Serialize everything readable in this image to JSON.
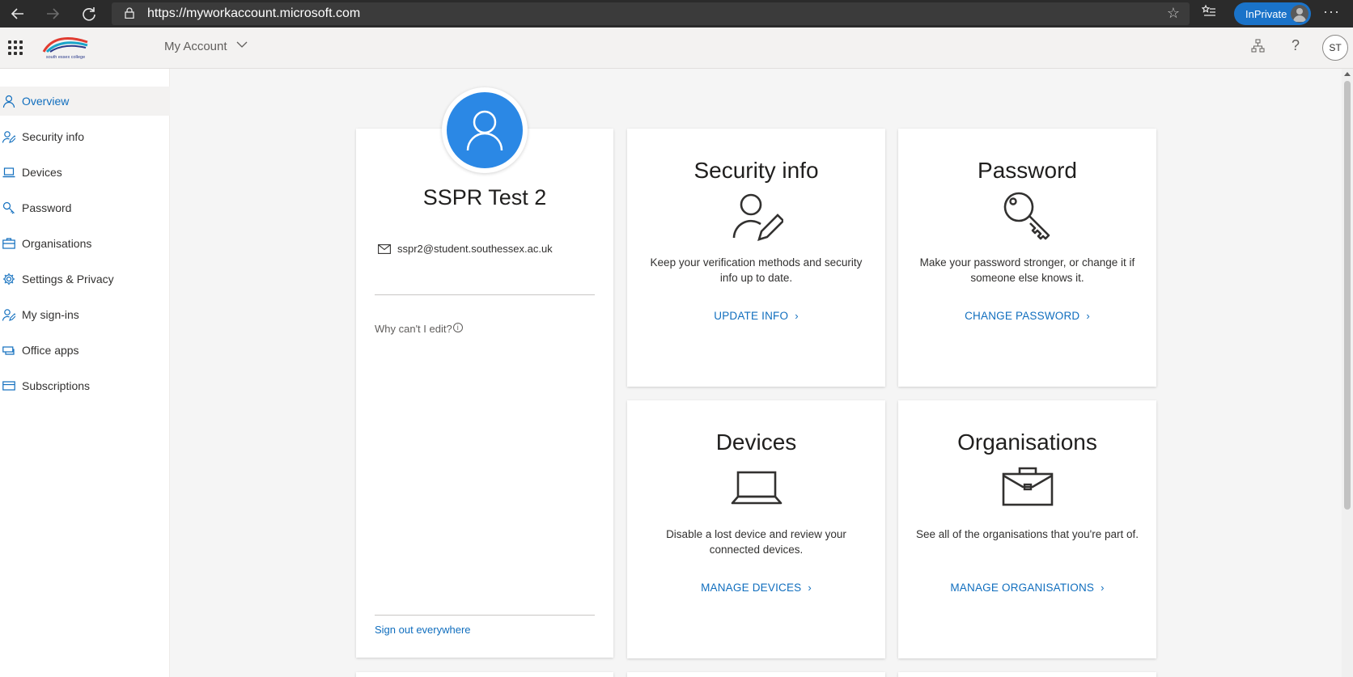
{
  "browser": {
    "url": "https://myworkaccount.microsoft.com",
    "inprivate_label": "InPrivate"
  },
  "header": {
    "app_title": "My Account",
    "logo_text": "south essex college",
    "avatar_initials": "ST"
  },
  "sidebar": {
    "items": [
      {
        "label": "Overview",
        "icon": "person-icon",
        "active": true
      },
      {
        "label": "Security info",
        "icon": "person-edit-icon"
      },
      {
        "label": "Devices",
        "icon": "laptop-icon"
      },
      {
        "label": "Password",
        "icon": "key-icon"
      },
      {
        "label": "Organisations",
        "icon": "briefcase-icon"
      },
      {
        "label": "Settings & Privacy",
        "icon": "gear-icon"
      },
      {
        "label": "My sign-ins",
        "icon": "person-edit-icon"
      },
      {
        "label": "Office apps",
        "icon": "apps-icon"
      },
      {
        "label": "Subscriptions",
        "icon": "card-icon"
      }
    ]
  },
  "profile": {
    "name": "SSPR Test 2",
    "email": "sspr2@student.southessex.ac.uk",
    "why_edit": "Why can't I edit?",
    "info_glyph": "i",
    "sign_out": "Sign out everywhere"
  },
  "tiles": {
    "security": {
      "title": "Security info",
      "description": "Keep your verification methods and security info up to date.",
      "link": "UPDATE INFO"
    },
    "password": {
      "title": "Password",
      "description": "Make your password stronger, or change it if someone else knows it.",
      "link": "CHANGE PASSWORD"
    },
    "devices": {
      "title": "Devices",
      "description": "Disable a lost device and review your connected devices.",
      "link": "MANAGE DEVICES"
    },
    "organisations": {
      "title": "Organisations",
      "description": "See all of the organisations that you're part of.",
      "link": "MANAGE ORGANISATIONS"
    }
  },
  "colors": {
    "accent": "#106ebe",
    "avatar_blue": "#2b88e5",
    "inprivate_blue": "#1a73c9"
  }
}
